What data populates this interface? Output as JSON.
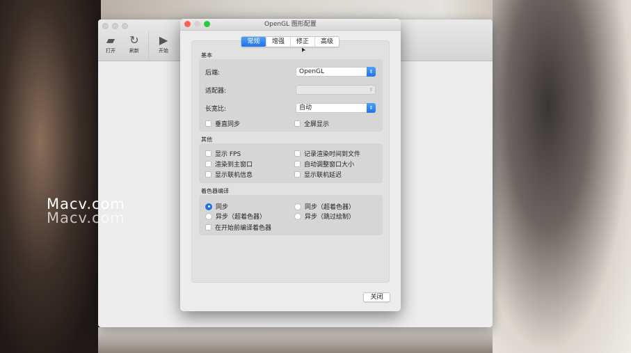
{
  "watermark": "Macv.com",
  "main_window": {
    "toolbar": [
      {
        "label": "打开",
        "icon": "folder-icon"
      },
      {
        "label": "刷新",
        "icon": "refresh-icon"
      },
      {
        "label": "开始",
        "icon": "play-icon"
      }
    ]
  },
  "dialog": {
    "title": "OpenGL 图形配置",
    "tabs": [
      {
        "label": "常规",
        "active": true
      },
      {
        "label": "增强"
      },
      {
        "label": "修正"
      },
      {
        "label": "高级"
      }
    ],
    "basic": {
      "heading": "基本",
      "backend_label": "后端:",
      "backend_value": "OpenGL",
      "adapter_label": "适配器:",
      "adapter_value": "",
      "aspect_label": "长宽比:",
      "aspect_value": "自动",
      "vsync": "垂直同步",
      "fullscreen": "全屏显示"
    },
    "other": {
      "heading": "其他",
      "items": [
        "显示 FPS",
        "记录渲染时间到文件",
        "渲染到主窗口",
        "自动调整窗口大小",
        "显示联机信息",
        "显示联机延迟"
      ]
    },
    "shader": {
      "heading": "着色器编译",
      "options": [
        "同步",
        "同步（超着色器）",
        "异步（超着色器）",
        "异步（跳过绘制）"
      ],
      "selected": 0,
      "precompile": "在开始前编译着色器"
    },
    "close_label": "关闭"
  },
  "colors": {
    "accent": "#1f73e8"
  }
}
